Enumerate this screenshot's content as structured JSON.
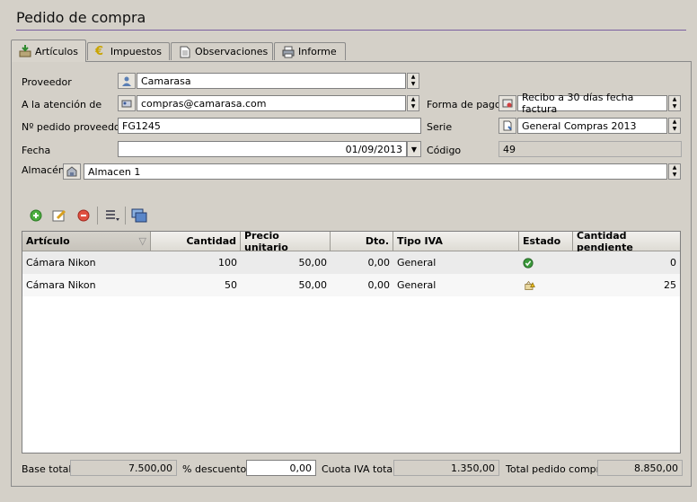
{
  "window": {
    "title": "Pedido de compra"
  },
  "tabs": [
    {
      "label": "Artículos",
      "icon": "box-download-icon"
    },
    {
      "label": "Impuestos",
      "icon": "euro-icon"
    },
    {
      "label": "Observaciones",
      "icon": "document-icon"
    },
    {
      "label": "Informe",
      "icon": "printer-icon"
    }
  ],
  "form": {
    "proveedor_label": "Proveedor",
    "proveedor_value": "Camarasa",
    "atencion_label": "A la atención de",
    "atencion_value": "compras@camarasa.com",
    "num_pedido_label": "Nº pedido proveedor",
    "num_pedido_value": "FG1245",
    "fecha_label": "Fecha",
    "fecha_value": "01/09/2013",
    "almacen_label": "Almacén",
    "almacen_value": "Almacen 1",
    "forma_pago_label": "Forma de pago",
    "forma_pago_value": "Recibo a 30 días fecha factura",
    "serie_label": "Serie",
    "serie_value": "General Compras 2013",
    "codigo_label": "Código",
    "codigo_value": "49"
  },
  "toolbar": {
    "icons": [
      "add-icon",
      "edit-icon",
      "delete-icon",
      "list-options-icon",
      "windows-icon"
    ]
  },
  "grid": {
    "columns": [
      "Artículo",
      "Cantidad",
      "Precio unitario",
      "Dto.",
      "Tipo IVA",
      "Estado",
      "Cantidad pendiente"
    ],
    "rows": [
      {
        "articulo": "Cámara Nikon",
        "cantidad": "100",
        "precio": "50,00",
        "dto": "0,00",
        "tipo_iva": "General",
        "estado": "check-icon",
        "pendiente": "0"
      },
      {
        "articulo": "Cámara Nikon",
        "cantidad": "50",
        "precio": "50,00",
        "dto": "0,00",
        "tipo_iva": "General",
        "estado": "pending-warning-icon",
        "pendiente": "25"
      }
    ]
  },
  "totals": {
    "base_label": "Base total",
    "base_value": "7.500,00",
    "descuento_label": "% descuento",
    "descuento_value": "0,00",
    "cuota_label": "Cuota IVA total",
    "cuota_value": "1.350,00",
    "total_label": "Total pedido compra",
    "total_value": "8.850,00"
  },
  "colors": {
    "title_underline": "#7a5fa0",
    "row_alt": "#f0f0f0",
    "check_green": "#3a9a3a"
  }
}
